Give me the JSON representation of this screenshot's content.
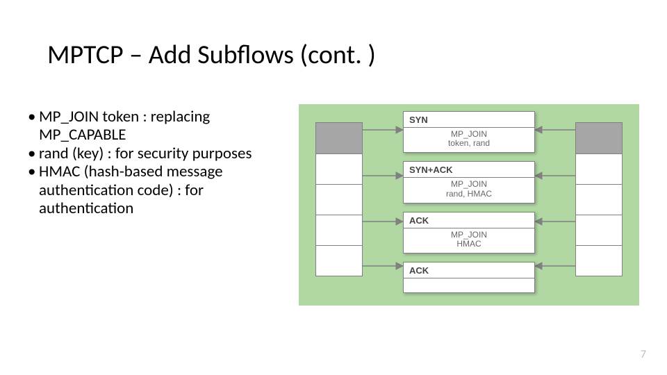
{
  "title": "MPTCP – Add Subflows (cont. )",
  "bullets": [
    "MP_JOIN token : replacing MP_CAPABLE",
    "rand (key) : for security purposes",
    "HMAC (hash-based message authentication code) : for authentication"
  ],
  "diagram": {
    "messages": [
      {
        "header": "SYN",
        "option": "MP_JOIN\ntoken, rand"
      },
      {
        "header": "SYN+ACK",
        "option": "MP_JOIN\nrand, HMAC"
      },
      {
        "header": "ACK",
        "option": "MP_JOIN\nHMAC"
      },
      {
        "header": "ACK",
        "option": ""
      }
    ]
  },
  "page_number": "7"
}
